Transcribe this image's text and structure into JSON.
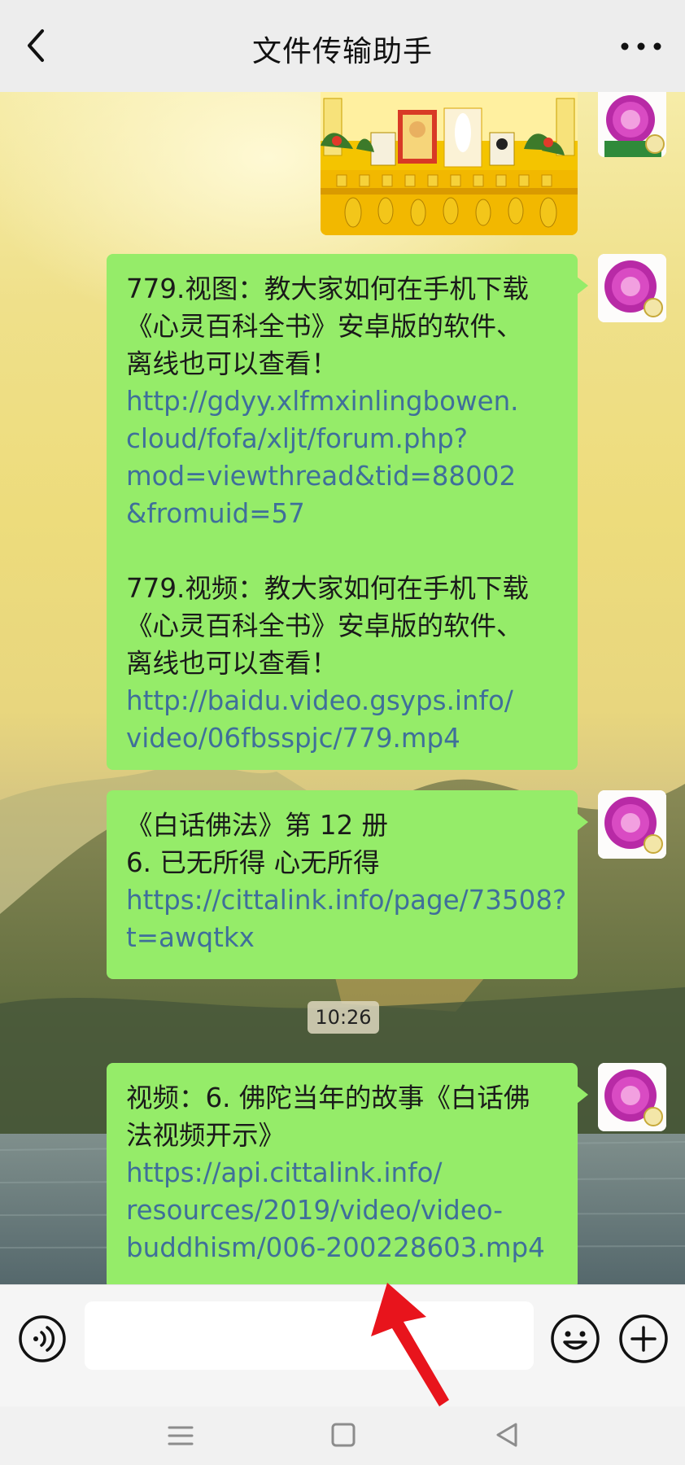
{
  "header": {
    "title": "文件传输助手",
    "back_icon": "chevron-left-icon",
    "more_icon": "more-dots-icon"
  },
  "messages": [
    {
      "type": "image",
      "description_icon": "shrine-image"
    },
    {
      "type": "text",
      "lines_a": [
        "779.视图：教大家如何在手机下载",
        "《心灵百科全书》安卓版的软件、",
        "离线也可以查看！"
      ],
      "links_a": [
        "http://gdyy.xlfmxinlingbowen.",
        "cloud/fofa/xljt/forum.php?",
        "mod=viewthread&tid=88002",
        "&fromuid=57"
      ],
      "lines_b": [
        "779.视频：教大家如何在手机下载",
        "《心灵百科全书》安卓版的软件、",
        "离线也可以查看！"
      ],
      "links_b": [
        "http://baidu.video.gsyps.info/",
        "video/06fbsspjc/779.mp4"
      ]
    },
    {
      "type": "text",
      "lines": [
        "《白话佛法》第 12 册",
        "6. 已无所得 心无所得"
      ],
      "links": [
        "https://cittalink.info/page/73508?",
        "t=awqtkx"
      ]
    },
    {
      "type": "text",
      "lines": [
        "视频：6. 佛陀当年的故事《白话佛",
        "法视频开示》"
      ],
      "links": [
        "https://api.cittalink.info/",
        "resources/2019/video/video-",
        "buddhism/006-200228603.mp4"
      ]
    }
  ],
  "timestamp": "10:26",
  "input": {
    "value": "",
    "placeholder": ""
  },
  "colors": {
    "bubble": "#95ec69",
    "link": "#3f6f9a",
    "header_bg": "#ededed",
    "annotation_arrow": "#e8141c"
  },
  "icons": {
    "voice": "voice-icon",
    "emoji": "emoji-icon",
    "plus": "plus-icon",
    "nav_menu": "menu-icon",
    "nav_home": "home-square-icon",
    "nav_back": "back-triangle-icon"
  }
}
